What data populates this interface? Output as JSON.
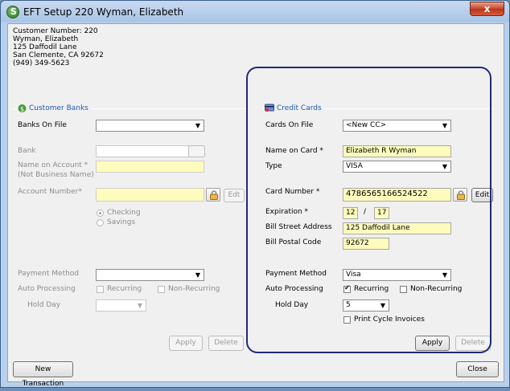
{
  "window": {
    "title": "EFT Setup 220 Wyman, Elizabeth",
    "close_glyph": "x"
  },
  "customer": {
    "number_line": "Customer Number: 220",
    "name": "Wyman, Elizabeth",
    "address1": "125 Daffodil Lane",
    "address2": "San Clemente, CA  92672",
    "phone": "(949) 349-5623"
  },
  "banks": {
    "title": "Customer Banks",
    "banks_on_file_label": "Banks On File",
    "banks_on_file_value": "",
    "bank_label": "Bank",
    "name_on_account_label": "Name on Account *",
    "name_on_account_sub": "(Not Business Name)",
    "account_number_label": "Account Number*",
    "edit_label": "Edt",
    "checking_label": "Checking",
    "savings_label": "Savings",
    "payment_method_label": "Payment Method",
    "auto_processing_label": "Auto Processing",
    "recurring_label": "Recurring",
    "non_recurring_label": "Non-Recurring",
    "hold_day_label": "Hold Day",
    "apply_label": "Apply",
    "delete_label": "Delete"
  },
  "cards": {
    "title": "Credit Cards",
    "cards_on_file_label": "Cards On File",
    "cards_on_file_value": "<New CC>",
    "name_on_card_label": "Name on Card *",
    "name_on_card_value": "Elizabeth R Wyman",
    "type_label": "Type",
    "type_value": "VISA",
    "card_number_label": "Card Number *",
    "card_number_value": "4786565166524522",
    "edit_label": "Edit",
    "expiration_label": "Expiration *",
    "exp_month": "12",
    "exp_sep": "/",
    "exp_year": "17",
    "bill_street_label": "Bill Street Address",
    "bill_street_value": "125 Daffodil Lane",
    "bill_postal_label": "Bill Postal Code",
    "bill_postal_value": "92672",
    "payment_method_label": "Payment Method",
    "payment_method_value": "Visa",
    "auto_processing_label": "Auto Processing",
    "recurring_label": "Recurring",
    "non_recurring_label": "Non-Recurring",
    "hold_day_label": "Hold Day",
    "hold_day_value": "5",
    "print_cycle_label": "Print Cycle Invoices",
    "apply_label": "Apply",
    "delete_label": "Delete"
  },
  "footer": {
    "new_transaction_label": "New Transaction",
    "close_label": "Close"
  }
}
